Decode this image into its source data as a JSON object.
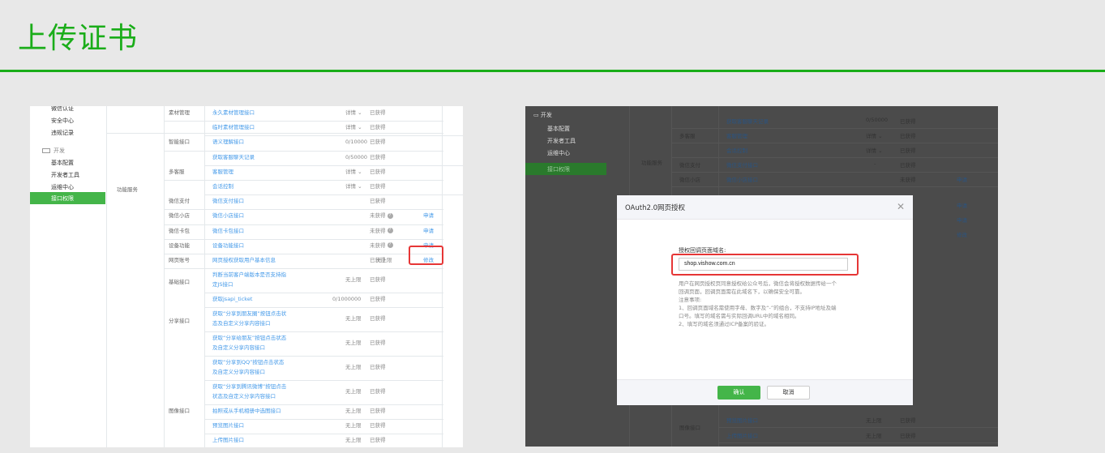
{
  "slide": {
    "title": "上传证书"
  },
  "left_shot": {
    "sidebar": {
      "items_top": [
        "微信认证",
        "安全中心",
        "违规记录"
      ],
      "group_label": "开发",
      "items_dev": [
        "基本配置",
        "开发者工具",
        "运维中心"
      ],
      "active": "接口权限"
    },
    "group_label": "功能服务",
    "rows": [
      {
        "cat": "素材管理",
        "name": "永久素材管理接口",
        "limit": "详情 ⌄",
        "status": "已获得",
        "op": ""
      },
      {
        "cat": "",
        "name": "临时素材管理接口",
        "limit": "详情 ⌄",
        "status": "已获得",
        "op": ""
      },
      {
        "cat": "智能接口",
        "name": "语义理解接口",
        "limit": "0/10000",
        "status": "已获得",
        "op": ""
      },
      {
        "cat": "",
        "name": "获取客服聊天记录",
        "limit": "0/50000",
        "status": "已获得",
        "op": ""
      },
      {
        "cat": "多客服",
        "name": "客服管理",
        "limit": "详情 ⌄",
        "status": "已获得",
        "op": ""
      },
      {
        "cat": "",
        "name": "会话控制",
        "limit": "详情 ⌄",
        "status": "已获得",
        "op": ""
      },
      {
        "cat": "微信支付",
        "name": "微信支付接口",
        "limit": "-",
        "status": "已获得",
        "op": ""
      },
      {
        "cat": "微信小店",
        "name": "微信小店接口",
        "limit": "",
        "status": "未获得",
        "op": "申请"
      },
      {
        "cat": "微信卡包",
        "name": "微信卡包接口",
        "limit": "",
        "status": "未获得",
        "op": "申请"
      },
      {
        "cat": "设备功能",
        "name": "设备功能接口",
        "limit": "",
        "status": "未获得",
        "op": "申请"
      },
      {
        "cat": "网页账号",
        "name": "网页授权获取用户基本信息",
        "limit": "无上限",
        "status": "已获得",
        "op": "修改"
      }
    ],
    "rows_multi": [
      {
        "cat": "基础接口",
        "name1": "判断当前客户端版本是否支持指",
        "name2": "定JS接口",
        "limit": "无上限",
        "status": "已获得"
      },
      {
        "cat": "",
        "name1": "获取jsapi_ticket",
        "name2": "",
        "limit": "0/1000000",
        "status": "已获得"
      },
      {
        "cat": "分享接口",
        "name1": "获取“分享到朋友圈”按钮点击状",
        "name2": "态及自定义分享内容接口",
        "limit": "无上限",
        "status": "已获得"
      },
      {
        "cat": "",
        "name1": "获取“分享给朋友”按钮点击状态",
        "name2": "及自定义分享内容接口",
        "limit": "无上限",
        "status": "已获得"
      },
      {
        "cat": "",
        "name1": "获取“分享到QQ”按钮点击状态",
        "name2": "及自定义分享内容接口",
        "limit": "无上限",
        "status": "已获得"
      },
      {
        "cat": "",
        "name1": "获取“分享到腾讯微博”按钮点击",
        "name2": "状态及自定义分享内容接口",
        "limit": "无上限",
        "status": "已获得"
      },
      {
        "cat": "图像接口",
        "name1": "拍照或从手机相册中选图接口",
        "name2": "",
        "limit": "无上限",
        "status": "已获得"
      },
      {
        "cat": "",
        "name1": "预览图片接口",
        "name2": "",
        "limit": "无上限",
        "status": "已获得"
      },
      {
        "cat": "",
        "name1": "上传图片接口",
        "name2": "",
        "limit": "无上限",
        "status": "已获得"
      }
    ]
  },
  "right_shot": {
    "sidebar": {
      "group_label": "开发",
      "items": [
        "基本配置",
        "开发者工具",
        "运维中心"
      ],
      "active": "接口权限"
    },
    "bg": {
      "group": "功能服务",
      "rows": [
        {
          "cat": "",
          "name": "获取客服聊天记录",
          "limit": "0/50000",
          "status": "已获得",
          "op": ""
        },
        {
          "cat": "多客服",
          "name": "客服管理",
          "limit": "详情 ⌄",
          "status": "已获得",
          "op": ""
        },
        {
          "cat": "",
          "name": "会话控制",
          "limit": "详情 ⌄",
          "status": "已获得",
          "op": ""
        },
        {
          "cat": "微信支付",
          "name": "微信支付接口",
          "limit": "-",
          "status": "已获得",
          "op": ""
        },
        {
          "cat": "微信小店",
          "name": "微信小店接口",
          "limit": "",
          "status": "未获得",
          "op": "申请"
        }
      ],
      "bottom_rows": [
        {
          "cat": "图像接口",
          "name": "预览图片接口",
          "limit": "无上限",
          "status": "已获得"
        },
        {
          "cat": "",
          "name": "上传图片接口",
          "limit": "无上限",
          "status": "已获得"
        }
      ],
      "side_ops": [
        "申请",
        "申请",
        "修改"
      ]
    },
    "dialog": {
      "title": "OAuth2.0网页授权",
      "label": "授权回调页面域名:",
      "input_value": "shop.vishow.com.cn",
      "notes": [
        "用户在网页授权页同意授权给公众号后，微信会将授权数据传给一个",
        "回调页面，回调页面需在此域名下，以确保安全可靠。",
        "注意事项:",
        "1、回调页面域名需使用字母、数字及“-”的组合，不支持IP地址及端",
        "口号。填写的域名需与实际回调URL中的域名相同。",
        "2、填写的域名须通过ICP备案的验证。"
      ],
      "ok_label": "确认",
      "cancel_label": "取消"
    }
  },
  "colors": {
    "accent": "#1aad19",
    "wechat_green": "#44b549",
    "link": "#459ae9",
    "highlight": "#e63636"
  }
}
